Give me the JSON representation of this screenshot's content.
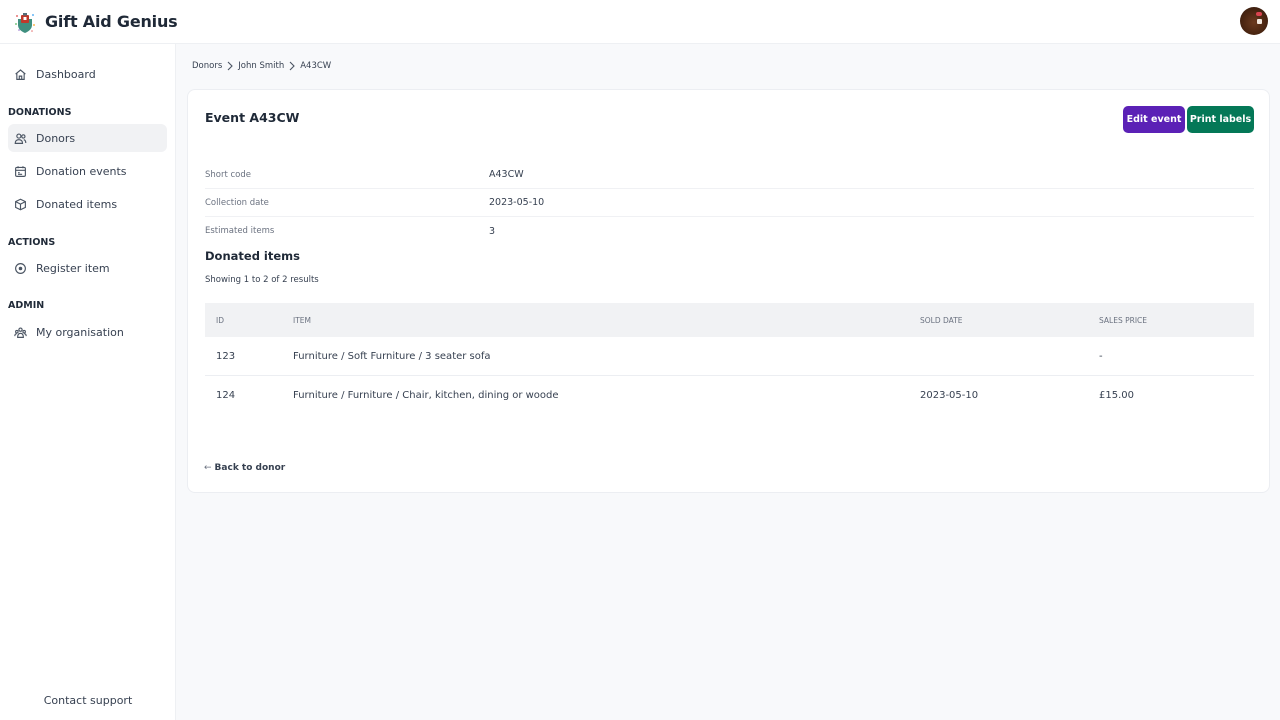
{
  "app": {
    "name": "Gift Aid Genius",
    "logo_icon": "charity-shield-logo",
    "avatar_icon": "user-avatar"
  },
  "sidebar": {
    "items": [
      {
        "label": "Dashboard",
        "icon": "home-icon",
        "active": false
      },
      {
        "section": "DONATIONS"
      },
      {
        "label": "Donors",
        "icon": "users-icon",
        "active": true
      },
      {
        "label": "Donation events",
        "icon": "calendar-icon",
        "active": false
      },
      {
        "label": "Donated items",
        "icon": "box-icon",
        "active": false
      },
      {
        "section": "ACTIONS"
      },
      {
        "label": "Register item",
        "icon": "plus-circle-icon",
        "active": false
      },
      {
        "section": "ADMIN"
      },
      {
        "label": "My organisation",
        "icon": "organisation-icon",
        "active": false
      }
    ],
    "dashboard": "Dashboard",
    "section_donations": "DONATIONS",
    "donors": "Donors",
    "donation_events": "Donation events",
    "donated_items": "Donated items",
    "section_actions": "ACTIONS",
    "register_item": "Register item",
    "section_admin": "ADMIN",
    "my_organisation": "My organisation",
    "contact_support": "Contact support"
  },
  "breadcrumb": [
    "Donors",
    "John Smith",
    "A43CW"
  ],
  "event": {
    "title": "Event A43CW",
    "edit_label": "Edit event",
    "print_label": "Print labels",
    "edit_color": "#5b21b6",
    "print_color": "#047857",
    "details": [
      {
        "label": "Short code",
        "value": "A43CW"
      },
      {
        "label": "Collection date",
        "value": "2023-05-10"
      },
      {
        "label": "Estimated items",
        "value": "3"
      }
    ]
  },
  "donated_items": {
    "title": "Donated items",
    "results_text": "Showing 1 to 2 of 2 results",
    "columns": [
      "ID",
      "ITEM",
      "SOLD DATE",
      "SALES PRICE"
    ],
    "rows": [
      {
        "id": "123",
        "item": "Furniture / Soft Furniture / 3 seater sofa",
        "sold_date": "",
        "sales_price": "-"
      },
      {
        "id": "124",
        "item": "Furniture / Furniture / Chair, kitchen, dining or woode",
        "sold_date": "2023-05-10",
        "sales_price": "£15.00"
      }
    ]
  },
  "back_link": {
    "arrow": "←",
    "label": "Back to donor"
  }
}
